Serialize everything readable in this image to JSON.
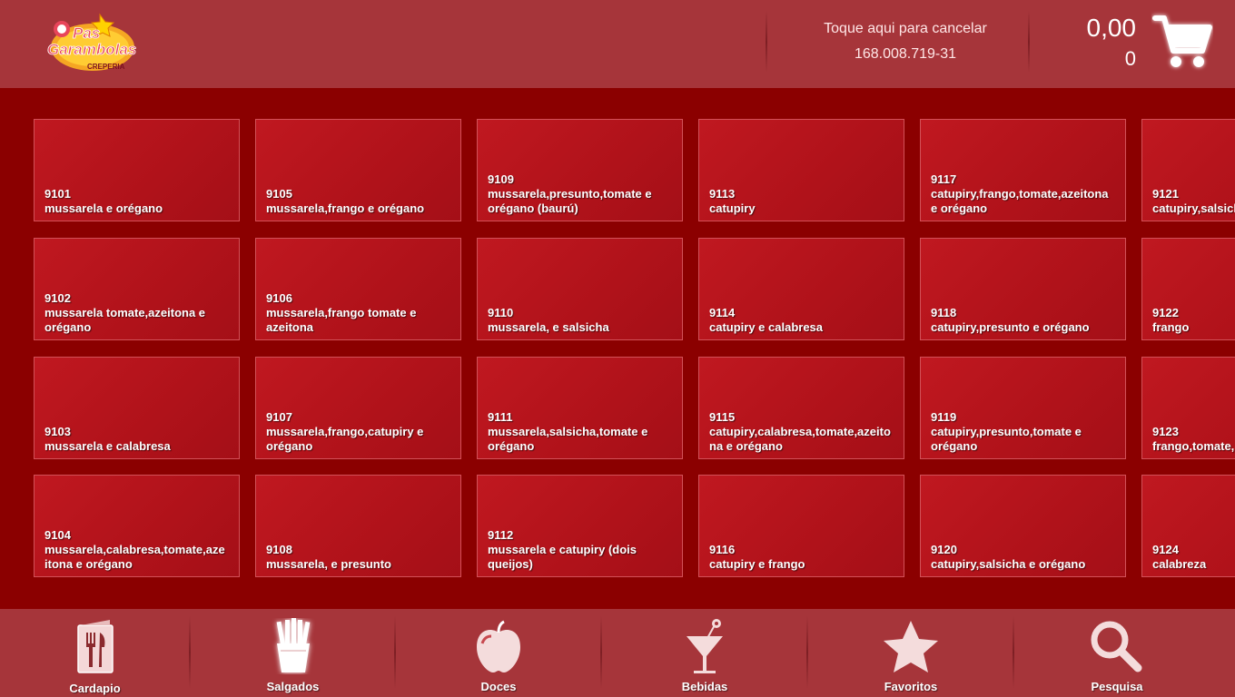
{
  "brand": {
    "logo_text_line1": "Pas",
    "logo_text_line2": "Garambolas",
    "logo_text_line3": "CREPERIA"
  },
  "header": {
    "cancel_label": "Toque aqui para cancelar",
    "document_number": "168.008.719-31",
    "cart_total": "0,00",
    "cart_count": "0"
  },
  "products": [
    {
      "code": "9101",
      "name": "mussarela e orégano"
    },
    {
      "code": "9105",
      "name": "mussarela,frango e orégano"
    },
    {
      "code": "9109",
      "name": "mussarela,presunto,tomate e orégano (baurú)"
    },
    {
      "code": "9113",
      "name": "catupiry"
    },
    {
      "code": "9117",
      "name": "catupiry,frango,tomate,azeitona e orégano"
    },
    {
      "code": "9121",
      "name": "catupiry,salsicha e orégano"
    },
    {
      "code": "9102",
      "name": "mussarela tomate,azeitona e orégano"
    },
    {
      "code": "9106",
      "name": "mussarela,frango tomate e azeitona"
    },
    {
      "code": "9110",
      "name": "mussarela, e salsicha"
    },
    {
      "code": "9114",
      "name": "catupiry e calabresa"
    },
    {
      "code": "9118",
      "name": "catupiry,presunto e orégano"
    },
    {
      "code": "9122",
      "name": "frango"
    },
    {
      "code": "9103",
      "name": "mussarela e calabresa"
    },
    {
      "code": "9107",
      "name": "mussarela,frango,catupiry e orégano"
    },
    {
      "code": "9111",
      "name": "mussarela,salsicha,tomate e orégano"
    },
    {
      "code": "9115",
      "name": "catupiry,calabresa,tomate,azeitona e orégano"
    },
    {
      "code": "9119",
      "name": "catupiry,presunto,tomate e orégano"
    },
    {
      "code": "9123",
      "name": "frango,tomate, e orégano"
    },
    {
      "code": "9104",
      "name": "mussarela,calabresa,tomate,azeitona e orégano"
    },
    {
      "code": "9108",
      "name": "mussarela, e presunto"
    },
    {
      "code": "9112",
      "name": "mussarela e catupiry (dois queijos)"
    },
    {
      "code": "9116",
      "name": "catupiry e frango"
    },
    {
      "code": "9120",
      "name": "catupiry,salsicha e orégano"
    },
    {
      "code": "9124",
      "name": "calabreza"
    }
  ],
  "nav": {
    "items": [
      {
        "label": "Cardapio",
        "icon": "menu-card-icon"
      },
      {
        "label": "Salgados",
        "icon": "fries-icon"
      },
      {
        "label": "Doces",
        "icon": "apple-icon"
      },
      {
        "label": "Bebidas",
        "icon": "cocktail-icon"
      },
      {
        "label": "Favoritos",
        "icon": "star-icon"
      },
      {
        "label": "Pesquisa",
        "icon": "search-icon"
      }
    ]
  },
  "colors": {
    "header_bg": "#a6353a",
    "content_bg": "#8b0000",
    "tile_bg": "#b5141b",
    "text": "#ffffff"
  }
}
